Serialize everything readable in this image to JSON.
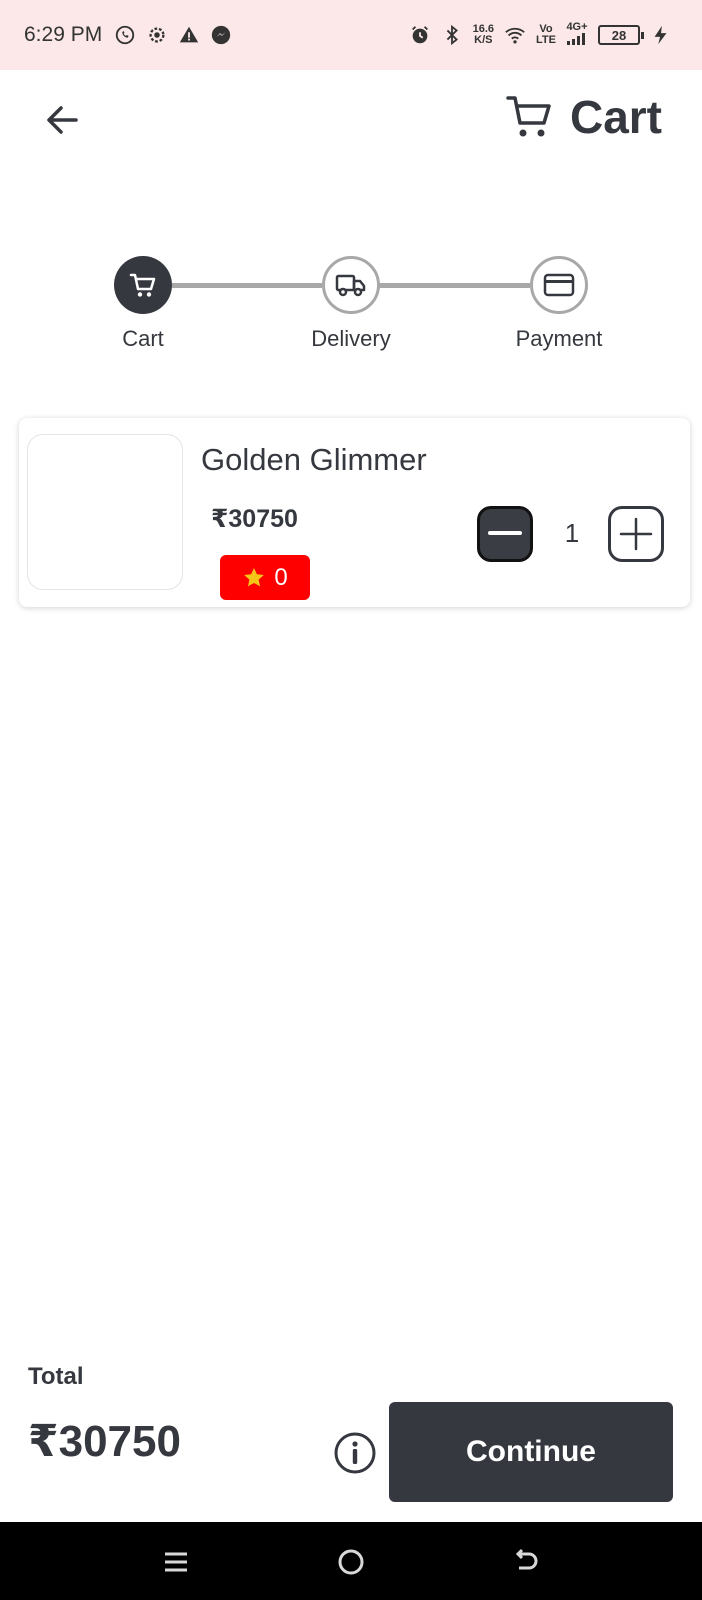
{
  "status_bar": {
    "time": "6:29 PM",
    "left_icons": [
      "whatsapp-icon",
      "settings-icon",
      "warning-icon",
      "messenger-icon"
    ],
    "speed_value": "16.6",
    "speed_unit": "K/S",
    "network_volte_top": "Vo",
    "network_volte_bottom": "LTE",
    "network_type": "4G+",
    "battery": "28"
  },
  "header": {
    "title": "Cart",
    "back_icon": "arrow-left-icon",
    "cart_icon": "cart-icon"
  },
  "stepper": {
    "steps": [
      {
        "label": "Cart",
        "icon": "cart-icon",
        "active": true
      },
      {
        "label": "Delivery",
        "icon": "truck-icon",
        "active": false
      },
      {
        "label": "Payment",
        "icon": "credit-card-icon",
        "active": false
      }
    ]
  },
  "cart_items": [
    {
      "name": "Golden Glimmer",
      "price": "₹30750",
      "rating": "0",
      "quantity": "1"
    }
  ],
  "footer": {
    "total_label": "Total",
    "total_value": "₹30750",
    "continue_label": "Continue"
  },
  "colors": {
    "primary": "#35383e",
    "status_bar_bg": "#fce8e8",
    "badge_red": "#ff0000",
    "star": "#f5c518",
    "step_inactive": "#a8a8a8"
  }
}
